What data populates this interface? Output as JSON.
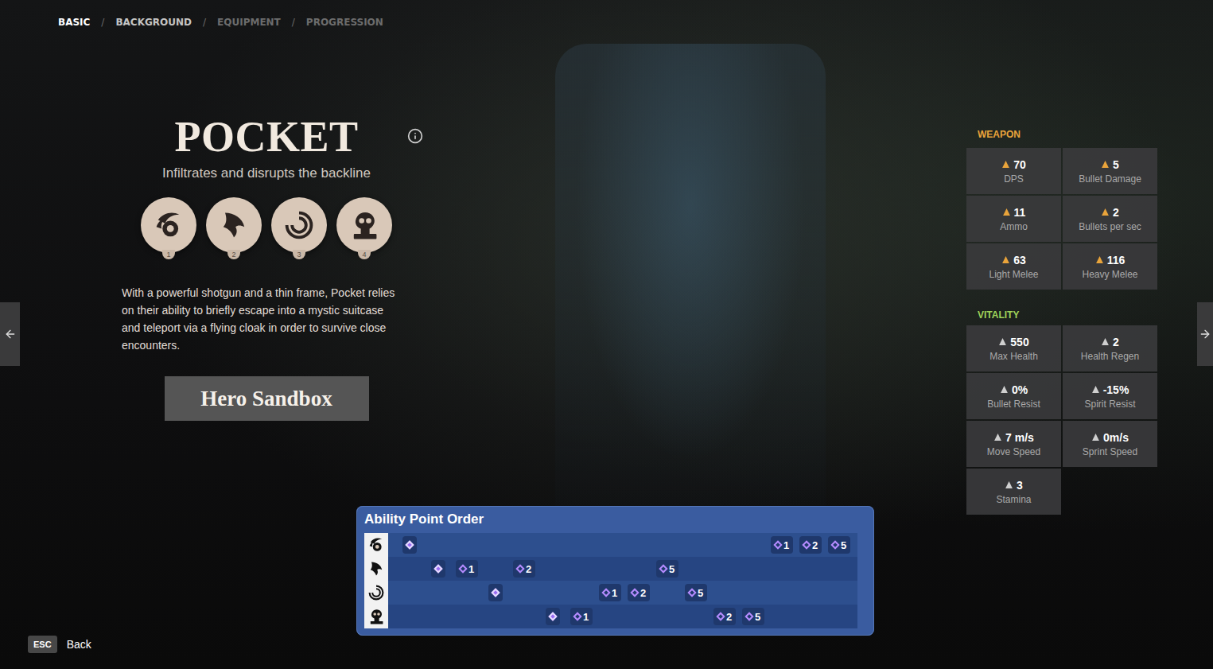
{
  "nav": {
    "separator": "/",
    "tabs": [
      {
        "label": "BASIC",
        "selected": true,
        "disabled": false
      },
      {
        "label": "BACKGROUND",
        "selected": false,
        "disabled": false
      },
      {
        "label": "EQUIPMENT",
        "selected": false,
        "disabled": true
      },
      {
        "label": "PROGRESSION",
        "selected": false,
        "disabled": true
      }
    ]
  },
  "hero": {
    "name": "POCKET",
    "tagline": "Infiltrates and disrupts the backline",
    "abilities": [
      {
        "number": "1"
      },
      {
        "number": "2"
      },
      {
        "number": "3"
      },
      {
        "number": "4"
      }
    ],
    "description": "With a powerful shotgun and a thin frame, Pocket relies on their ability to briefly escape into a mystic suitcase and teleport via a flying cloak in order to survive close encounters.",
    "sandbox_button": "Hero Sandbox"
  },
  "weapon": {
    "title": "WEAPON",
    "stats": [
      {
        "value": "70",
        "label": "DPS"
      },
      {
        "value": "5",
        "label": "Bullet Damage"
      },
      {
        "value": "11",
        "label": "Ammo"
      },
      {
        "value": "2",
        "label": "Bullets per sec"
      },
      {
        "value": "63",
        "label": "Light Melee"
      },
      {
        "value": "116",
        "label": "Heavy Melee"
      }
    ]
  },
  "vitality": {
    "title": "VITALITY",
    "stats": [
      {
        "value": "550",
        "label": "Max Health"
      },
      {
        "value": "2",
        "label": "Health Regen"
      },
      {
        "value": "0%",
        "label": "Bullet Resist"
      },
      {
        "value": "-15%",
        "label": "Spirit Resist"
      },
      {
        "value": "7 m/s",
        "label": "Move Speed"
      },
      {
        "value": "0m/s",
        "label": "Sprint Speed"
      },
      {
        "value": "3",
        "label": "Stamina"
      }
    ]
  },
  "ability_order": {
    "title": "Ability Point Order",
    "rows": [
      {
        "points": [
          {
            "step": 0,
            "kind": "unlock"
          },
          {
            "step": 13,
            "kind": "upgrade",
            "label": "1"
          },
          {
            "step": 14,
            "kind": "upgrade",
            "label": "2"
          },
          {
            "step": 15,
            "kind": "upgrade",
            "label": "5"
          }
        ]
      },
      {
        "points": [
          {
            "step": 1,
            "kind": "unlock"
          },
          {
            "step": 2,
            "kind": "upgrade",
            "label": "1"
          },
          {
            "step": 4,
            "kind": "upgrade",
            "label": "2"
          },
          {
            "step": 9,
            "kind": "upgrade",
            "label": "5"
          }
        ]
      },
      {
        "points": [
          {
            "step": 3,
            "kind": "unlock"
          },
          {
            "step": 7,
            "kind": "upgrade",
            "label": "1"
          },
          {
            "step": 8,
            "kind": "upgrade",
            "label": "2"
          },
          {
            "step": 10,
            "kind": "upgrade",
            "label": "5"
          }
        ]
      },
      {
        "points": [
          {
            "step": 5,
            "kind": "unlock"
          },
          {
            "step": 6,
            "kind": "upgrade",
            "label": "1"
          },
          {
            "step": 11,
            "kind": "upgrade",
            "label": "2"
          },
          {
            "step": 12,
            "kind": "upgrade",
            "label": "5"
          }
        ]
      }
    ]
  },
  "footer": {
    "key": "ESC",
    "label": "Back"
  }
}
